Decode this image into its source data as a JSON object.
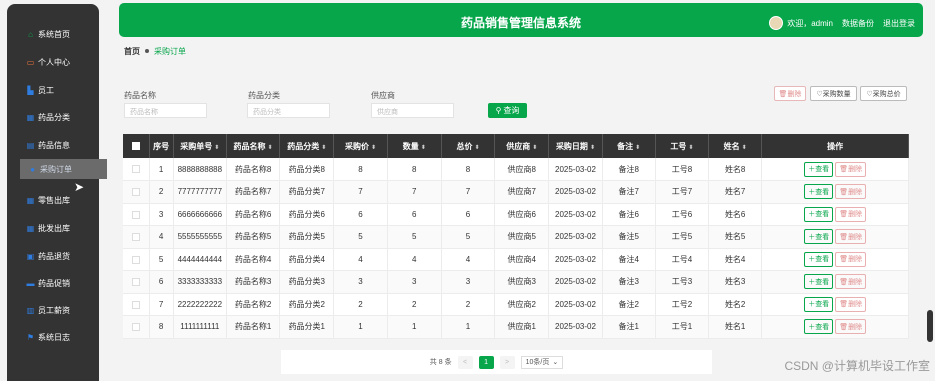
{
  "app": {
    "title": "药品销售管理信息系统",
    "welcome": "欢迎，admin",
    "backup": "数据备份",
    "logout": "退出登录"
  },
  "sidebar": {
    "items": [
      {
        "label": "系统首页",
        "icon": "home-icon"
      },
      {
        "label": "个人中心",
        "icon": "profile-icon"
      },
      {
        "label": "员工",
        "icon": "user-icon"
      },
      {
        "label": "药品分类",
        "icon": "grid-icon"
      },
      {
        "label": "药品信息",
        "icon": "doc-icon"
      },
      {
        "label": "采购订单",
        "icon": "cart-icon"
      },
      {
        "label": "零售出库",
        "icon": "grid-icon"
      },
      {
        "label": "批发出库",
        "icon": "grid-icon"
      },
      {
        "label": "药品退货",
        "icon": "box-icon"
      },
      {
        "label": "药品促销",
        "icon": "monitor-icon"
      },
      {
        "label": "员工薪资",
        "icon": "wallet-icon"
      },
      {
        "label": "系统日志",
        "icon": "flag-icon"
      }
    ],
    "active_index": 5
  },
  "breadcrumb": {
    "home": "首页",
    "current": "采购订单"
  },
  "filters": {
    "name_label": "药品名称",
    "name_placeholder": "药品名称",
    "cat_label": "药品分类",
    "cat_placeholder": "药品分类",
    "supplier_label": "供应商",
    "supplier_placeholder": "供应商",
    "search_label": "查询"
  },
  "toolbar": {
    "delete": "删除",
    "qty": "采购数量",
    "total": "采购总价"
  },
  "table": {
    "headers": [
      "序号",
      "采购单号",
      "药品名称",
      "药品分类",
      "采购价",
      "数量",
      "总价",
      "供应商",
      "采购日期",
      "备注",
      "工号",
      "姓名",
      "操作"
    ],
    "view_label": "查看",
    "delete_label": "删除",
    "rows": [
      [
        "1",
        "8888888888",
        "药品名称8",
        "药品分类8",
        "8",
        "8",
        "8",
        "供应商8",
        "2025-03-02",
        "备注8",
        "工号8",
        "姓名8"
      ],
      [
        "2",
        "7777777777",
        "药品名称7",
        "药品分类7",
        "7",
        "7",
        "7",
        "供应商7",
        "2025-03-02",
        "备注7",
        "工号7",
        "姓名7"
      ],
      [
        "3",
        "6666666666",
        "药品名称6",
        "药品分类6",
        "6",
        "6",
        "6",
        "供应商6",
        "2025-03-02",
        "备注6",
        "工号6",
        "姓名6"
      ],
      [
        "4",
        "5555555555",
        "药品名称5",
        "药品分类5",
        "5",
        "5",
        "5",
        "供应商5",
        "2025-03-02",
        "备注5",
        "工号5",
        "姓名5"
      ],
      [
        "5",
        "4444444444",
        "药品名称4",
        "药品分类4",
        "4",
        "4",
        "4",
        "供应商4",
        "2025-03-02",
        "备注4",
        "工号4",
        "姓名4"
      ],
      [
        "6",
        "3333333333",
        "药品名称3",
        "药品分类3",
        "3",
        "3",
        "3",
        "供应商3",
        "2025-03-02",
        "备注3",
        "工号3",
        "姓名3"
      ],
      [
        "7",
        "2222222222",
        "药品名称2",
        "药品分类2",
        "2",
        "2",
        "2",
        "供应商2",
        "2025-03-02",
        "备注2",
        "工号2",
        "姓名2"
      ],
      [
        "8",
        "1111111111",
        "药品名称1",
        "药品分类1",
        "1",
        "1",
        "1",
        "供应商1",
        "2025-03-02",
        "备注1",
        "工号1",
        "姓名1"
      ]
    ]
  },
  "pager": {
    "total": "共 8 条",
    "prev": "<",
    "page": "1",
    "next": ">",
    "size": "10条/页"
  },
  "watermark": "CSDN @计算机毕设工作室",
  "colors": {
    "accent": "#07a64b",
    "sidebar": "#333333",
    "danger": "#e08b8b"
  }
}
